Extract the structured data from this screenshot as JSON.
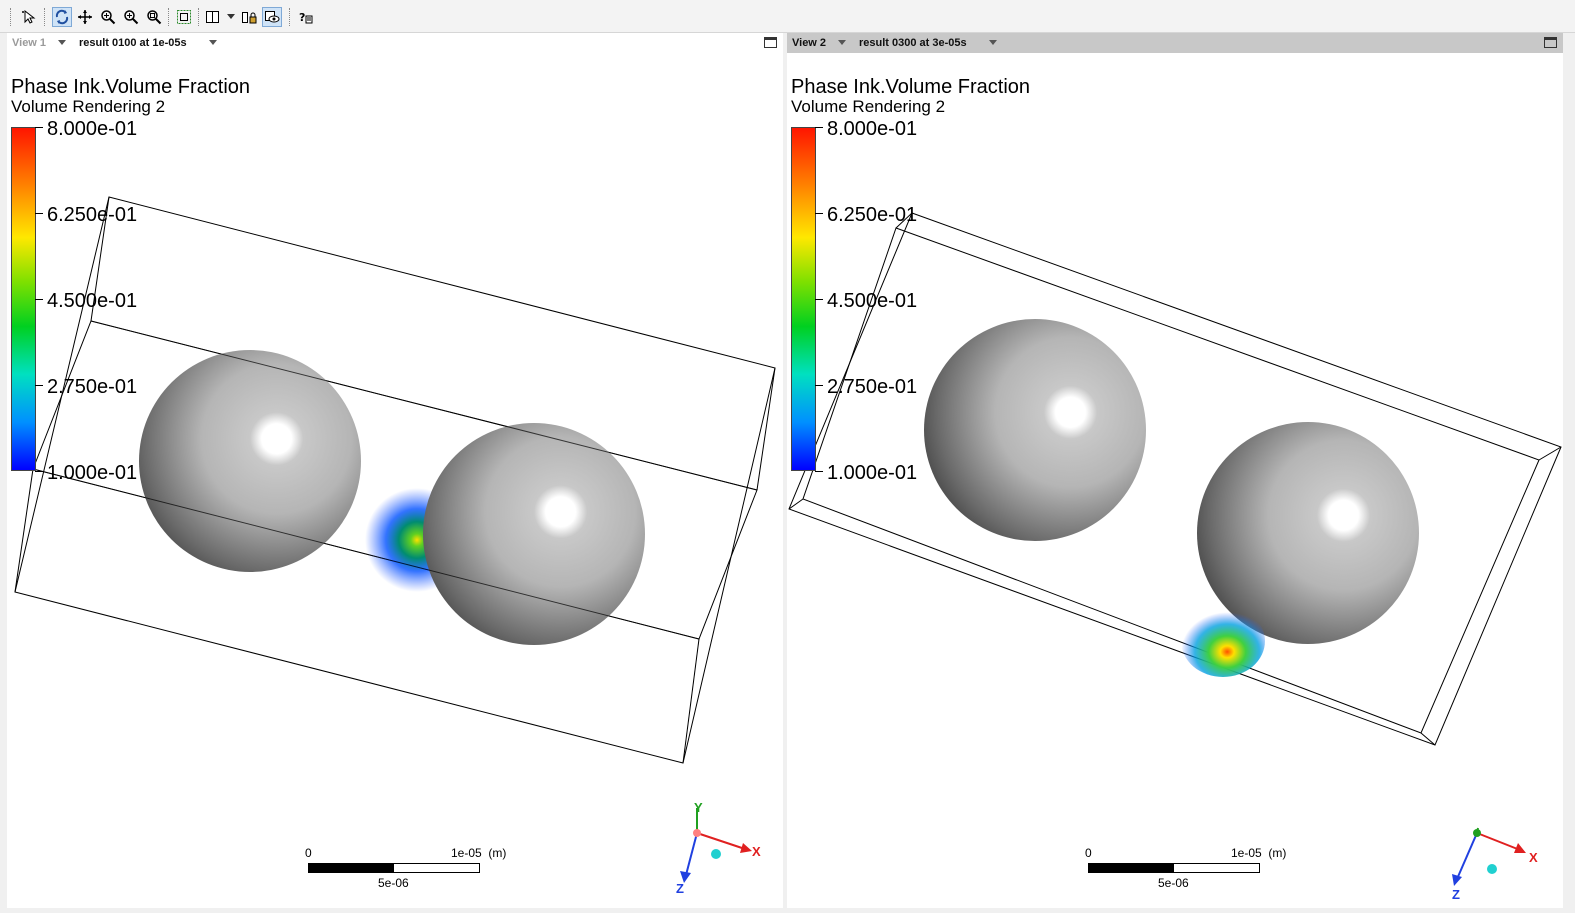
{
  "toolbar": {
    "tools": [
      "select-icon",
      "rotate-icon",
      "pan-icon",
      "zoom-box-icon",
      "zoom-icon",
      "zoom-fit-icon",
      "fit-view-icon",
      "viewport-layout-icon",
      "lock-views-icon",
      "sync-views-icon",
      "help-icon"
    ],
    "active": [
      "rotate-icon",
      "sync-views-icon"
    ]
  },
  "views": [
    {
      "name": "View 1",
      "result": "result 0100 at 1e-05s",
      "legend": {
        "title": "Phase Ink.Volume Fraction",
        "subtitle": "Volume Rendering 2",
        "ticks": [
          "8.000e-01",
          "6.250e-01",
          "4.500e-01",
          "2.750e-01",
          "1.000e-01"
        ]
      },
      "scale": {
        "zero": "0",
        "max": "1e-05",
        "unit": "(m)",
        "mid": "5e-06"
      },
      "axes": {
        "y": "Y",
        "x": "X",
        "z": "Z"
      }
    },
    {
      "name": "View 2",
      "result": "result 0300 at 3e-05s",
      "legend": {
        "title": "Phase Ink.Volume Fraction",
        "subtitle": "Volume Rendering 2",
        "ticks": [
          "8.000e-01",
          "6.250e-01",
          "4.500e-01",
          "2.750e-01",
          "1.000e-01"
        ]
      },
      "scale": {
        "zero": "0",
        "max": "1e-05",
        "unit": "(m)",
        "mid": "5e-06"
      },
      "axes": {
        "y": "Y",
        "x": "X",
        "z": "Z"
      }
    }
  ],
  "colors": {
    "accent_active": "#cfe3f7",
    "active_header": "#c8c8c8",
    "colorbar_max": "#ff1500",
    "colorbar_min": "#0000ff",
    "axis_x": "#e02020",
    "axis_y": "#20a020",
    "axis_z": "#2040e0"
  }
}
